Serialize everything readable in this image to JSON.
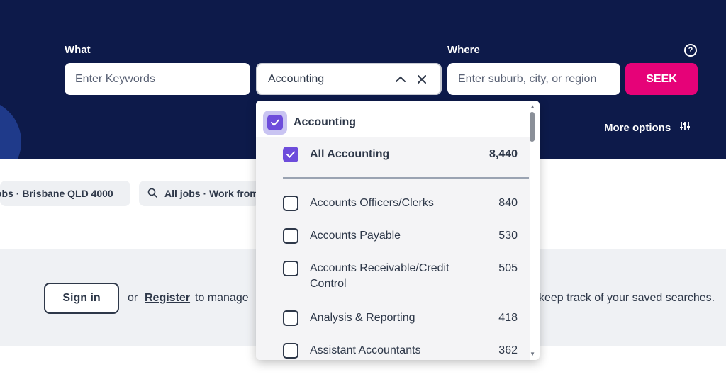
{
  "search": {
    "what_label": "What",
    "where_label": "Where",
    "keywords_placeholder": "Enter Keywords",
    "classification_value": "Accounting",
    "where_placeholder": "Enter suburb, city, or region",
    "seek_label": "SEEK",
    "more_options_label": "More options",
    "help_symbol": "?"
  },
  "recent": {
    "chip1": "obs · Brisbane QLD 4000",
    "chip2": "All jobs · Work from"
  },
  "signin_band": {
    "signin_label": "Sign in",
    "or_text": "or",
    "register_label": "Register",
    "manage_text": "to manage",
    "keep_text": "keep track of your saved searches."
  },
  "dropdown": {
    "parent_label": "Accounting",
    "items": [
      {
        "label": "All Accounting",
        "count": "8,440"
      },
      {
        "label": "Accounts Officers/Clerks",
        "count": "840"
      },
      {
        "label": "Accounts Payable",
        "count": "530"
      },
      {
        "label": "Accounts Receivable/Credit Control",
        "count": "505"
      },
      {
        "label": "Analysis & Reporting",
        "count": "418"
      },
      {
        "label": "Assistant Accountants",
        "count": "362"
      }
    ]
  },
  "colors": {
    "hero_bg": "#0d1a4a",
    "seek_pink": "#e60278",
    "checkbox_purple": "#6d4cdb"
  },
  "icons": [
    "help-icon",
    "chevron-up-icon",
    "close-icon",
    "tune-icon",
    "search-icon",
    "check-icon"
  ]
}
